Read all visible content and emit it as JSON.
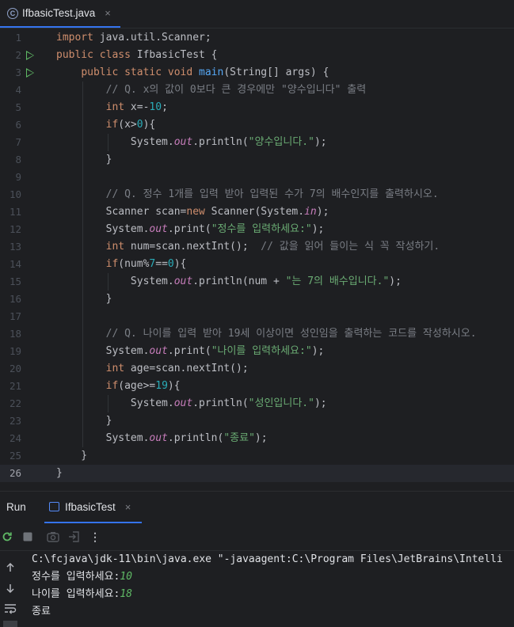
{
  "editor_tab": {
    "file_name": "IfbasicTest.java",
    "close": "×",
    "icon_letter": "C"
  },
  "code": {
    "line_numbers": [
      "1",
      "2",
      "3",
      "4",
      "5",
      "6",
      "7",
      "8",
      "9",
      "10",
      "11",
      "12",
      "13",
      "14",
      "15",
      "16",
      "17",
      "18",
      "19",
      "20",
      "21",
      "22",
      "23",
      "24",
      "25",
      "26"
    ],
    "run_markers_lines": [
      2,
      3
    ],
    "current_line": 26,
    "lines": [
      [
        [
          "kw",
          "import"
        ],
        [
          "p",
          " java.util.Scanner;"
        ]
      ],
      [
        [
          "kw",
          "public class"
        ],
        [
          "p",
          " IfbasicTest {"
        ]
      ],
      [
        [
          "p",
          "    "
        ],
        [
          "kw",
          "public static void"
        ],
        [
          "p",
          " "
        ],
        [
          "fn",
          "main"
        ],
        [
          "p",
          "(String[] args) {"
        ]
      ],
      [
        [
          "cmt",
          "        // Q. x의 값이 0보다 큰 경우에만 \"양수입니다\" 출력"
        ]
      ],
      [
        [
          "p",
          "        "
        ],
        [
          "kw",
          "int"
        ],
        [
          "p",
          " x=-"
        ],
        [
          "num",
          "10"
        ],
        [
          "p",
          ";"
        ]
      ],
      [
        [
          "p",
          "        "
        ],
        [
          "kw",
          "if"
        ],
        [
          "p",
          "(x>"
        ],
        [
          "num",
          "0"
        ],
        [
          "p",
          "){"
        ]
      ],
      [
        [
          "p",
          "            System."
        ],
        [
          "fld",
          "out"
        ],
        [
          "p",
          ".println("
        ],
        [
          "str",
          "\"양수입니다.\""
        ],
        [
          "p",
          ");"
        ]
      ],
      [
        [
          "p",
          "        }"
        ]
      ],
      [
        [
          "p",
          ""
        ]
      ],
      [
        [
          "cmt",
          "        // Q. 정수 1개를 입력 받아 입력된 수가 7의 배수인지를 출력하시오."
        ]
      ],
      [
        [
          "p",
          "        Scanner scan="
        ],
        [
          "kw",
          "new"
        ],
        [
          "p",
          " Scanner(System."
        ],
        [
          "fld",
          "in"
        ],
        [
          "p",
          ");"
        ]
      ],
      [
        [
          "p",
          "        System."
        ],
        [
          "fld",
          "out"
        ],
        [
          "p",
          ".print("
        ],
        [
          "str",
          "\"정수를 입력하세요:\""
        ],
        [
          "p",
          ");"
        ]
      ],
      [
        [
          "p",
          "        "
        ],
        [
          "kw",
          "int"
        ],
        [
          "p",
          " num=scan.nextInt();  "
        ],
        [
          "cmt",
          "// 값을 읽어 들이는 식 꼭 작성하기."
        ]
      ],
      [
        [
          "p",
          "        "
        ],
        [
          "kw",
          "if"
        ],
        [
          "p",
          "(num%"
        ],
        [
          "num",
          "7"
        ],
        [
          "p",
          "=="
        ],
        [
          "num",
          "0"
        ],
        [
          "p",
          "){"
        ]
      ],
      [
        [
          "p",
          "            System."
        ],
        [
          "fld",
          "out"
        ],
        [
          "p",
          ".println(num + "
        ],
        [
          "str",
          "\"는 7의 배수입니다.\""
        ],
        [
          "p",
          ");"
        ]
      ],
      [
        [
          "p",
          "        }"
        ]
      ],
      [
        [
          "p",
          ""
        ]
      ],
      [
        [
          "cmt",
          "        // Q. 나이를 입력 받아 19세 이상이면 성인임을 출력하는 코드를 작성하시오."
        ]
      ],
      [
        [
          "p",
          "        System."
        ],
        [
          "fld",
          "out"
        ],
        [
          "p",
          ".print("
        ],
        [
          "str",
          "\"나이를 입력하세요:\""
        ],
        [
          "p",
          ");"
        ]
      ],
      [
        [
          "p",
          "        "
        ],
        [
          "kw",
          "int"
        ],
        [
          "p",
          " age=scan.nextInt();"
        ]
      ],
      [
        [
          "p",
          "        "
        ],
        [
          "kw",
          "if"
        ],
        [
          "p",
          "(age>="
        ],
        [
          "num",
          "19"
        ],
        [
          "p",
          "){"
        ]
      ],
      [
        [
          "p",
          "            System."
        ],
        [
          "fld",
          "out"
        ],
        [
          "p",
          ".println("
        ],
        [
          "str",
          "\"성인입니다.\""
        ],
        [
          "p",
          ");"
        ]
      ],
      [
        [
          "p",
          "        }"
        ]
      ],
      [
        [
          "p",
          "        System."
        ],
        [
          "fld",
          "out"
        ],
        [
          "p",
          ".println("
        ],
        [
          "str",
          "\"종료\""
        ],
        [
          "p",
          ");"
        ]
      ],
      [
        [
          "p",
          "    }"
        ]
      ],
      [
        [
          "p",
          "}"
        ]
      ]
    ]
  },
  "run_panel": {
    "title": "Run",
    "tab_label": "IfbasicTest",
    "tab_close": "×",
    "toolbar_icons": [
      "rerun-icon",
      "stop-icon",
      "camera-icon",
      "exit-icon",
      "more-icon"
    ],
    "side_icons": [
      "scroll-up-icon",
      "scroll-down-icon",
      "soft-wrap-icon"
    ],
    "console": [
      {
        "text": "C:\\fcjava\\jdk-11\\bin\\java.exe \"-javaagent:C:\\Program Files\\JetBrains\\Intelli",
        "input": ""
      },
      {
        "text": "정수를 입력하세요:",
        "input": "10"
      },
      {
        "text": "나이를 입력하세요:",
        "input": "18"
      },
      {
        "text": "종료",
        "input": ""
      }
    ]
  },
  "colors": {
    "background": "#1e1f22",
    "keyword": "#cf8e6d",
    "string": "#6aab73",
    "number": "#2aacb8",
    "comment": "#7a7e85",
    "field": "#c77dbb",
    "method": "#56a8f5",
    "accent": "#3574f0"
  }
}
